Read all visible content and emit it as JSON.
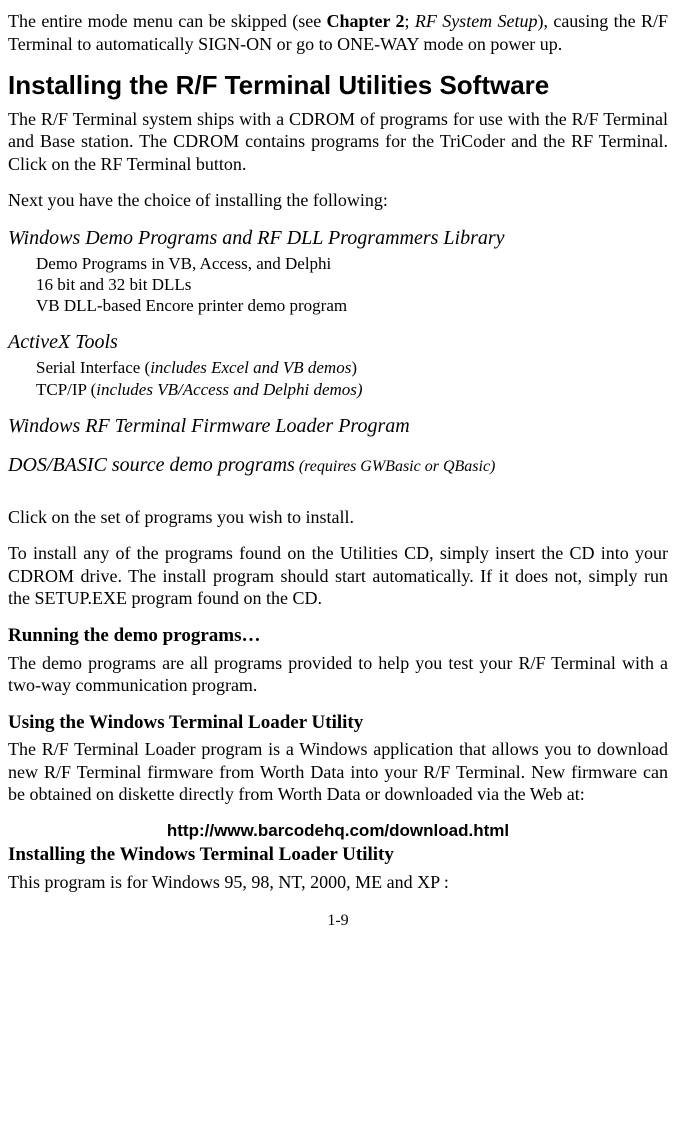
{
  "intro": {
    "line1_pre": "The entire mode menu can be skipped (see ",
    "line1_bold": "Chapter 2",
    "line1_semi": "; ",
    "line1_ital": "RF System Setup",
    "line1_post": "), causing the R/F Terminal to automatically SIGN-ON or go to ONE-WAY mode on power up."
  },
  "installing_title": "Installing the R/F Terminal Utilities Software",
  "installing_para": "The R/F Terminal system ships with a CDROM of programs for use with the R/F Terminal and Base station. The CDROM contains programs for the TriCoder and the RF Terminal.  Click on the RF Terminal button.",
  "next_choice": "Next you have the choice of installing the following:",
  "win_demo_heading": "Windows Demo Programs and RF DLL Programmers Library",
  "win_demo_items": [
    "Demo Programs in VB, Access, and Delphi",
    "16 bit and 32 bit DLLs",
    " VB DLL-based Encore printer demo program"
  ],
  "activex_heading": "ActiveX Tools",
  "activex_items": [
    {
      "pre": "Serial Interface (",
      "ital": "includes Excel and VB demos",
      "post": ")"
    },
    {
      "pre": "TCP/IP (",
      "ital": "includes VB/Access and Delphi demos)",
      "post": ""
    }
  ],
  "firmware_heading": "Windows RF Terminal Firmware Loader Program",
  "dosbasic_heading": "DOS/BASIC source demo programs",
  "dosbasic_paren": " (requires GWBasic or QBasic)",
  "click_para": "Click on the set of programs you wish to install.",
  "install_cd_para": "To install any of the programs found on the Utilities CD, simply insert the CD into your CDROM drive. The install program should start automatically.  If it does not, simply run the SETUP.EXE program found on the CD.",
  "running_title": "Running the demo programs…",
  "running_para": "The demo programs are all programs provided to help you test your R/F Terminal with a two-way communication program.",
  "using_title": "Using the Windows Terminal Loader Utility",
  "using_para": "The R/F Terminal Loader program is a Windows application that allows you to download new R/F Terminal firmware from Worth Data into your R/F Terminal. New firmware can be obtained on diskette directly from Worth Data or downloaded via the Web at:",
  "url": "http://www.barcodehq.com/download.html",
  "installing_loader_title": "Installing the Windows Terminal Loader Utility",
  "installing_loader_para": "This program is for Windows  95, 98, NT, 2000, ME and  XP :",
  "page_number": "1-9"
}
